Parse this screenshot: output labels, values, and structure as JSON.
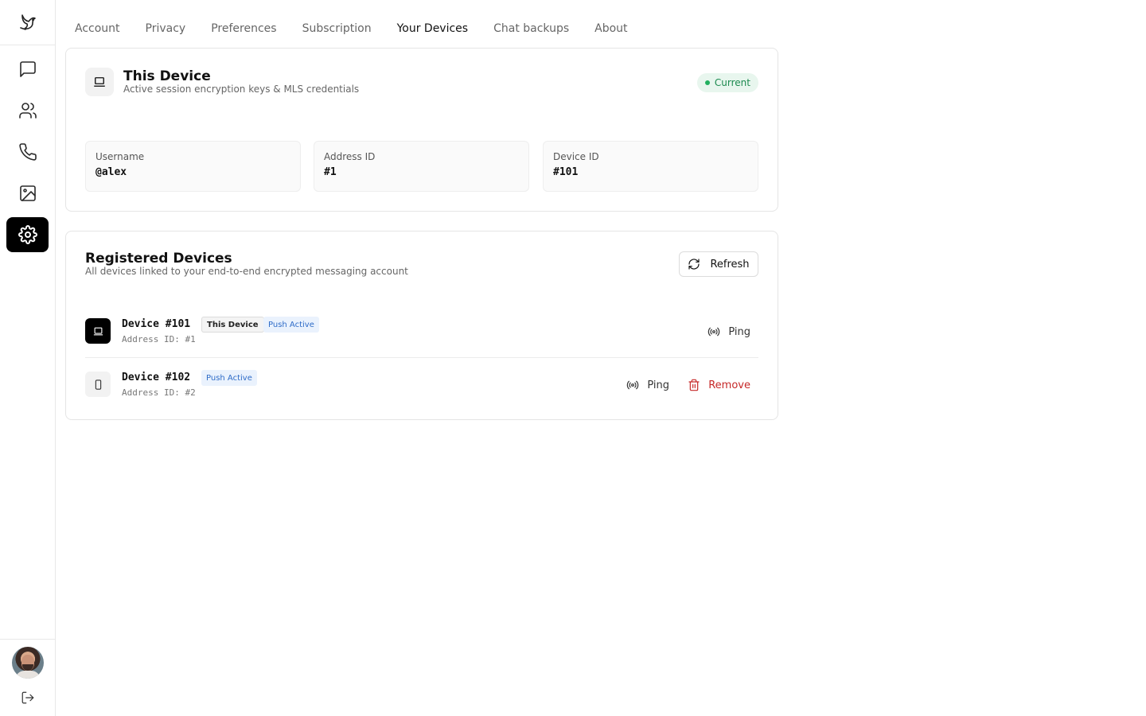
{
  "sidebar": {
    "items": [
      {
        "name": "chats",
        "icon": "message-square-icon"
      },
      {
        "name": "contacts",
        "icon": "users-icon"
      },
      {
        "name": "calls",
        "icon": "phone-icon"
      },
      {
        "name": "media",
        "icon": "image-icon"
      },
      {
        "name": "settings",
        "icon": "gear-icon",
        "active": true
      }
    ]
  },
  "tabs": [
    "Account",
    "Privacy",
    "Preferences",
    "Subscription",
    "Your Devices",
    "Chat backups",
    "About"
  ],
  "active_tab": "Your Devices",
  "this_device": {
    "title": "This Device",
    "subtitle": "Active session encryption keys & MLS credentials",
    "badge": "Current",
    "fields": [
      {
        "label": "Username",
        "value": "@alex"
      },
      {
        "label": "Address ID",
        "value": "#1"
      },
      {
        "label": "Device ID",
        "value": "#101"
      }
    ]
  },
  "registered": {
    "title": "Registered Devices",
    "subtitle": "All devices linked to your end-to-end encrypted messaging account",
    "refresh_label": "Refresh",
    "devices": [
      {
        "name": "Device #101",
        "address": "Address ID: #1",
        "this_device_tag": "This Device",
        "push_tag": "Push Active",
        "ping_label": "Ping"
      },
      {
        "name": "Device #102",
        "address": "Address ID: #2",
        "push_tag": "Push Active",
        "ping_label": "Ping",
        "remove_label": "Remove"
      }
    ]
  },
  "colors": {
    "accent": "#000000",
    "current_badge_bg": "#e8f6ee",
    "current_badge_text": "#1c8a4f",
    "push_tag_text": "#2f6cc8",
    "danger": "#c62828"
  }
}
